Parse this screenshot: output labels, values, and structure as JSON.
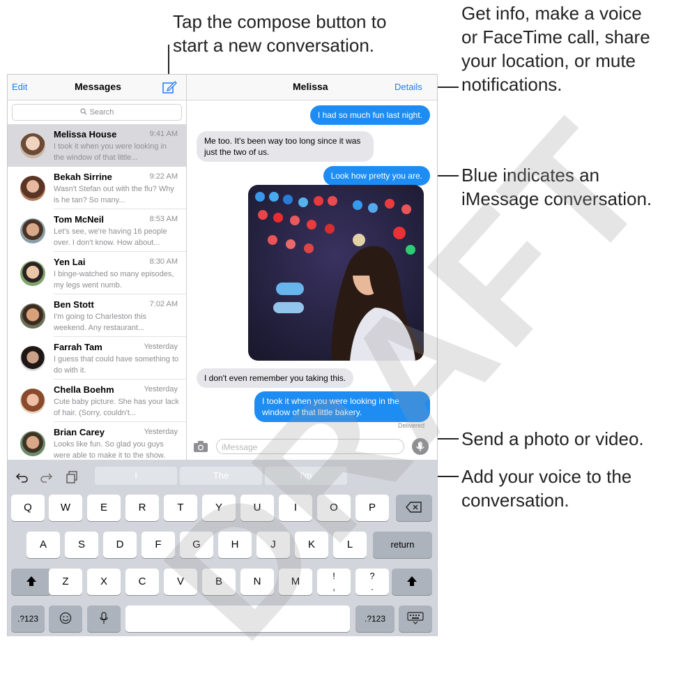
{
  "callouts": {
    "compose": [
      "Tap the compose button to",
      "start a new conversation."
    ],
    "details": [
      "Get info, make a voice",
      "or FaceTime call, share",
      "your location, or mute",
      "notifications."
    ],
    "blue": [
      "Blue indicates an",
      "iMessage conversation."
    ],
    "photo": "Send a photo or video.",
    "voice": [
      "Add your voice to the",
      "conversation."
    ]
  },
  "sidebar": {
    "edit": "Edit",
    "title": "Messages",
    "search_placeholder": "Search",
    "rows": [
      {
        "name": "Melissa House",
        "time": "9:41 AM",
        "preview": "I took it when you were looking in the window of that little..."
      },
      {
        "name": "Bekah Sirrine",
        "time": "9:22 AM",
        "preview": "Wasn't Stefan out with the flu? Why is he tan? So many..."
      },
      {
        "name": "Tom McNeil",
        "time": "8:53 AM",
        "preview": "Let's see, we're having 16 people over. I don't know. How about..."
      },
      {
        "name": "Yen Lai",
        "time": "8:30 AM",
        "preview": "I binge-watched so many episodes, my legs went numb."
      },
      {
        "name": "Ben Stott",
        "time": "7:02 AM",
        "preview": "I'm going to Charleston this weekend. Any restaurant..."
      },
      {
        "name": "Farrah Tam",
        "time": "Yesterday",
        "preview": "I guess that could have something to do with it."
      },
      {
        "name": "Chella Boehm",
        "time": "Yesterday",
        "preview": "Cute baby picture. She has your lack of hair. (Sorry, couldn't..."
      },
      {
        "name": "Brian Carey",
        "time": "Yesterday",
        "preview": "Looks like fun. So glad you guys were able to make it to the show."
      }
    ]
  },
  "conversation": {
    "title": "Melissa",
    "details": "Details",
    "messages": [
      "I had so much fun last night.",
      "Me too. It's been way too long since it was just the two of us.",
      "Look how pretty you are.",
      "I don't even remember you taking this.",
      "I took it when you were looking in the window of that little bakery."
    ],
    "delivered": "Delivered",
    "input_placeholder": "iMessage"
  },
  "keyboard": {
    "suggestions": [
      "I",
      "The",
      "I'm"
    ],
    "row1": [
      "Q",
      "W",
      "E",
      "R",
      "T",
      "Y",
      "U",
      "I",
      "O",
      "P"
    ],
    "row2": [
      "A",
      "S",
      "D",
      "F",
      "G",
      "H",
      "J",
      "K",
      "L"
    ],
    "row3": [
      "Z",
      "X",
      "C",
      "V",
      "B",
      "N",
      "M",
      "!\n,",
      "?\n."
    ],
    "return": "return",
    "numbers": ".?123"
  },
  "watermark": "DRAFT"
}
